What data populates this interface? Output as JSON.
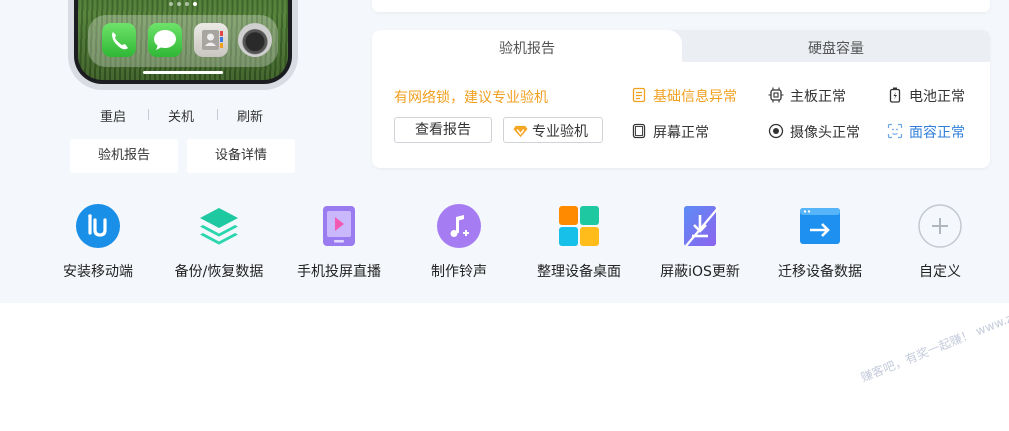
{
  "phone": {
    "actions": [
      {
        "label": "重启"
      },
      {
        "label": "关机"
      },
      {
        "label": "刷新"
      }
    ],
    "buttons": [
      {
        "label": "验机报告"
      },
      {
        "label": "设备详情"
      }
    ]
  },
  "report_card": {
    "tabs": [
      {
        "label": "验机报告",
        "active": true
      },
      {
        "label": "硬盘容量",
        "active": false
      }
    ],
    "warning": "有网络锁，建议专业验机",
    "view_report": "查看报告",
    "pro_check": "专业验机",
    "statuses": [
      {
        "label": "基础信息异常",
        "icon": "document-icon",
        "state": "warn"
      },
      {
        "label": "主板正常",
        "icon": "chip-icon",
        "state": "normal"
      },
      {
        "label": "电池正常",
        "icon": "battery-icon",
        "state": "normal"
      },
      {
        "label": "屏幕正常",
        "icon": "screen-icon",
        "state": "normal"
      },
      {
        "label": "摄像头正常",
        "icon": "camera-icon",
        "state": "normal"
      },
      {
        "label": "面容正常",
        "icon": "face-id-icon",
        "state": "blue"
      }
    ]
  },
  "tools": [
    {
      "label": "安装移动端",
      "icon": "install-mobile-icon",
      "color": "#1a8fe8"
    },
    {
      "label": "备份/恢复数据",
      "icon": "layers-icon",
      "color": "#1ec8a0"
    },
    {
      "label": "手机投屏直播",
      "icon": "screen-cast-icon",
      "color": "#9a7cf0"
    },
    {
      "label": "制作铃声",
      "icon": "music-note-icon",
      "color": "#a57cf2"
    },
    {
      "label": "整理设备桌面",
      "icon": "grid-apps-icon",
      "color": "#ff8a00"
    },
    {
      "label": "屏蔽iOS更新",
      "icon": "block-update-icon",
      "color": "#7b6ff0"
    },
    {
      "label": "迁移设备数据",
      "icon": "transfer-icon",
      "color": "#1e90f0"
    },
    {
      "label": "自定义",
      "icon": "plus-icon",
      "color": "#bfc5cc"
    }
  ],
  "watermark": "赚客吧，有奖一起赚！ www.zuanke8.com"
}
